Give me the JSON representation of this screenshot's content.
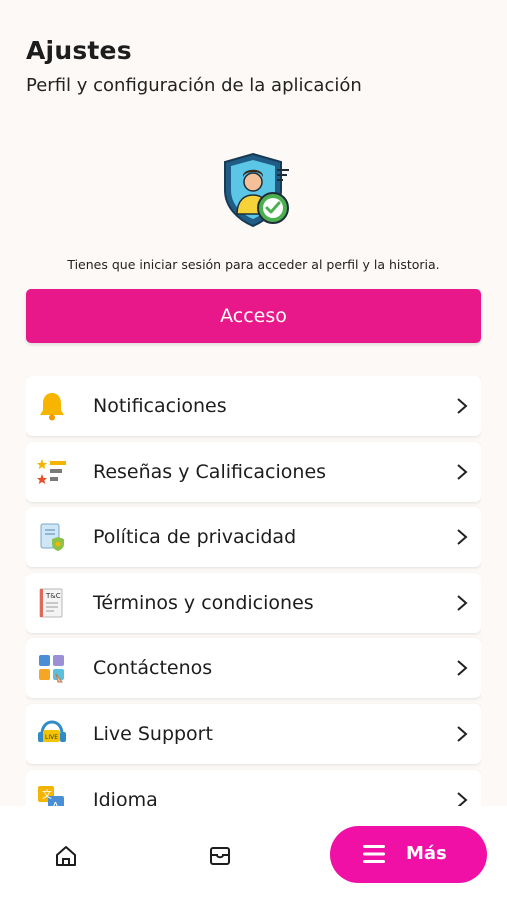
{
  "header": {
    "title": "Ajustes",
    "subtitle": "Perfil y configuración de la aplicación"
  },
  "login": {
    "notice": "Tienes que iniciar sesión para acceder al perfil y la historia.",
    "button_label": "Acceso",
    "button_color": "#e8178a"
  },
  "menu": {
    "items": [
      {
        "label": "Notificaciones",
        "icon": "bell-icon"
      },
      {
        "label": "Reseñas y Calificaciones",
        "icon": "star-rating-icon"
      },
      {
        "label": "Política de privacidad",
        "icon": "privacy-document-icon"
      },
      {
        "label": "Términos y condiciones",
        "icon": "terms-document-icon"
      },
      {
        "label": "Contáctenos",
        "icon": "contact-icon"
      },
      {
        "label": "Live Support",
        "icon": "live-support-icon"
      },
      {
        "label": "Idioma",
        "icon": "language-icon"
      }
    ]
  },
  "bottom_nav": {
    "home_icon": "home-icon",
    "shop_icon": "shop-box-icon",
    "more_label": "Más",
    "more_color": "#f010a6"
  }
}
